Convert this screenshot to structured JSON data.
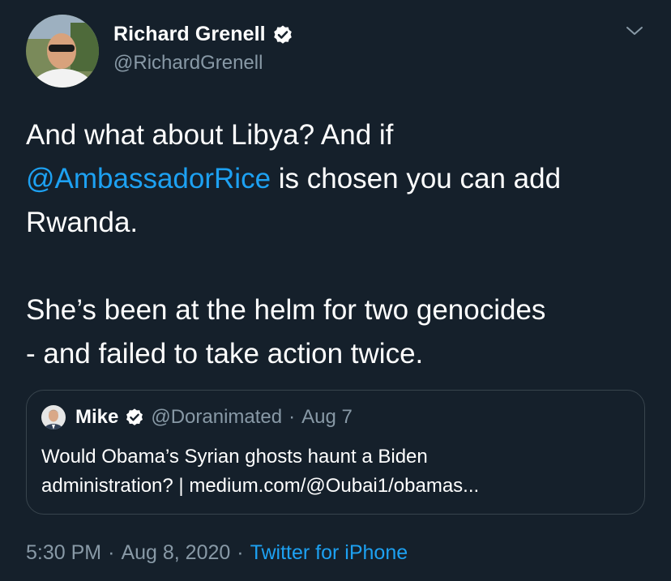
{
  "author": {
    "name": "Richard Grenell",
    "handle": "@RichardGrenell",
    "verified": true
  },
  "tweet": {
    "line1": "And what about Libya? And if",
    "mention": "@AmbassadorRice",
    "line2_rest": " is chosen you can add",
    "line3": "Rwanda.",
    "line4": "She’s been at the helm for two genocides",
    "line5": "- and failed to take action twice."
  },
  "quote": {
    "name": "Mike",
    "handle": "@Doranimated",
    "separator": "·",
    "date": "Aug 7",
    "text_line1": "Would Obama’s Syrian ghosts haunt a Biden",
    "text_line2": "administration? | medium.com/@Oubai1/obamas..."
  },
  "meta": {
    "time": "5:30 PM",
    "separator": "·",
    "date": "Aug 8, 2020",
    "source": "Twitter for iPhone"
  },
  "icons": {
    "verified": "verified-badge-icon",
    "caret": "chevron-down-icon"
  },
  "colors": {
    "background": "#15202b",
    "accent": "#1da1f2",
    "secondary_text": "#8899a6",
    "border": "#38444d"
  }
}
